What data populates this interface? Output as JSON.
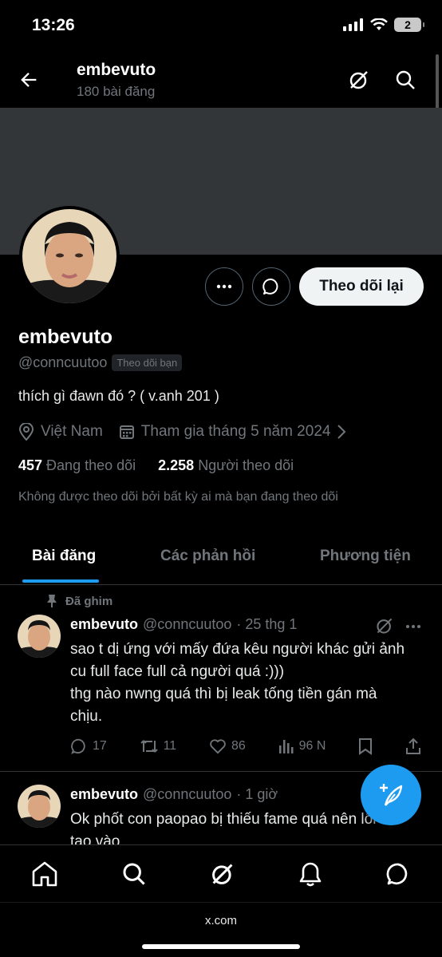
{
  "status": {
    "time": "13:26",
    "battery": "2"
  },
  "header": {
    "name": "embevuto",
    "post_count": "180 bài đăng"
  },
  "profile": {
    "display_name": "embevuto",
    "handle": "@conncuutoo",
    "follows_you": "Theo dõi bạn",
    "follow_back_label": "Theo dõi lại",
    "bio": "thích gì đawn đó ? ( v.anh 201 )",
    "location": "Việt Nam",
    "joined": "Tham gia tháng 5 năm 2024",
    "following_count": "457",
    "following_label": "Đang theo dõi",
    "followers_count": "2.258",
    "followers_label": "Người theo dõi",
    "not_followed_note": "Không được theo dõi bởi bất kỳ ai mà bạn đang theo dõi"
  },
  "tabs": [
    {
      "label": "Bài đăng",
      "active": true
    },
    {
      "label": "Các phản hồi",
      "active": false
    },
    {
      "label": "Phương tiện",
      "active": false
    }
  ],
  "posts": [
    {
      "pinned_label": "Đã ghim",
      "name": "embevuto",
      "handle": "@conncuutoo",
      "time": "· 25 thg 1",
      "text": "sao t dị ứng với mấy đứa kêu người khác gửi ảnh\ncu full face full cả người quá :)))\nthg nào nwng quá thì bị leak tống tiền gán mà\nchịu.",
      "replies": "17",
      "reposts": "11",
      "likes": "86",
      "views": "96 N"
    },
    {
      "name": "embevuto",
      "handle": "@conncuutoo",
      "time": "· 1 giờ",
      "text": "Ok phốt con paopao bị thiếu fame quá nên lôi\ntao vào"
    }
  ],
  "bottom_nav": [
    "home-icon",
    "search-icon",
    "grok-icon",
    "notifications-icon",
    "messages-icon"
  ],
  "browser": {
    "url": "x.com"
  },
  "colors": {
    "accent": "#1d9bf0",
    "banner": "#333639",
    "background": "#000000"
  }
}
